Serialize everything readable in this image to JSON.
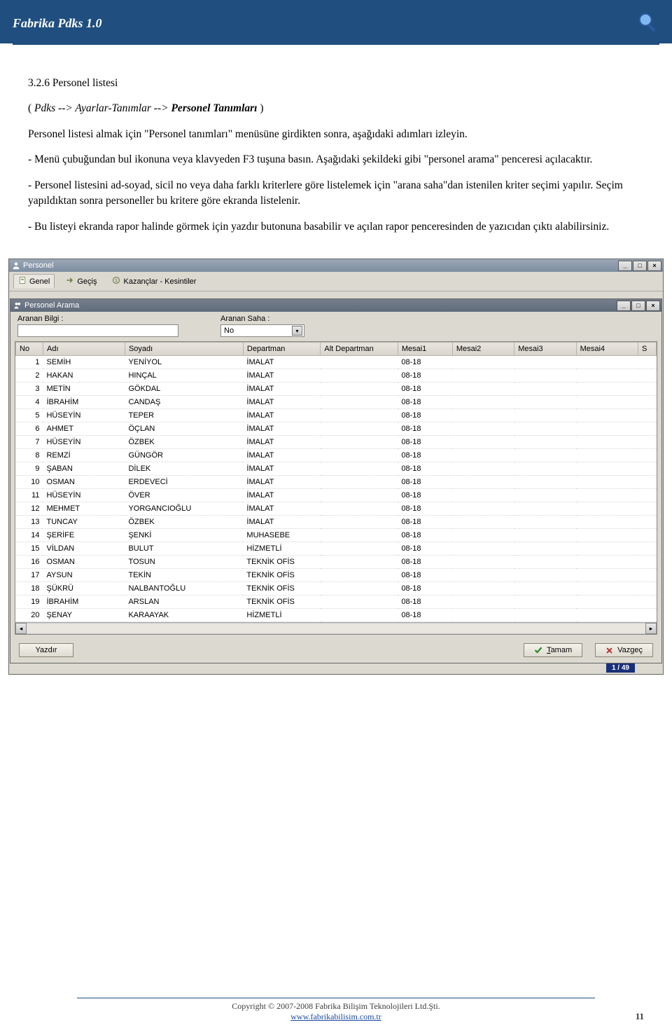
{
  "header": {
    "title": "Fabrika Pdks 1.0"
  },
  "section": {
    "title": "3.2.6 Personel listesi",
    "breadcrumb_open": "( ",
    "breadcrumb_italic": "Pdks --> Ayarlar-Tanımlar --> ",
    "breadcrumb_bold": "Personel Tanımları",
    "breadcrumb_close": " )",
    "p1": "Personel listesi almak için \"Personel tanımları\" menüsüne girdikten sonra, aşağıdaki adımları izleyin.",
    "p2": "- Menü çubuğundan bul ikonuna veya klavyeden F3 tuşuna basın. Aşağıdaki şekildeki gibi \"personel arama\" penceresi açılacaktır.",
    "p3": "- Personel listesini ad-soyad, sicil no veya daha farklı kriterlere göre listelemek için \"arana saha\"dan istenilen kriter seçimi yapılır. Seçim yapıldıktan sonra personeller bu kritere göre ekranda listelenir.",
    "p4": "- Bu listeyi ekranda rapor halinde görmek için yazdır butonuna basabilir ve açılan rapor penceresinden de yazıcıdan çıktı alabilirsiniz."
  },
  "outer_window": {
    "title": "Personel",
    "tabs": [
      "Genel",
      "Geçiş",
      "Kazançlar - Kesintiler"
    ]
  },
  "inner_window": {
    "title": "Personel Arama",
    "search_label_left": "Aranan Bilgi  :",
    "search_label_right": "Aranan Saha  :",
    "search_value": "",
    "select_value": "No"
  },
  "table": {
    "columns": [
      "No",
      "Adı",
      "Soyadı",
      "Departman",
      "Alt Departman",
      "Mesai1",
      "Mesai2",
      "Mesai3",
      "Mesai4",
      "S"
    ],
    "rows": [
      {
        "no": "1",
        "ad": "SEMİH",
        "soyad": "YENİYOL",
        "dep": "İMALAT",
        "altdep": "",
        "m1": "08-18",
        "m2": "",
        "m3": "",
        "m4": ""
      },
      {
        "no": "2",
        "ad": "HAKAN",
        "soyad": "HINÇAL",
        "dep": "İMALAT",
        "altdep": "",
        "m1": "08-18",
        "m2": "",
        "m3": "",
        "m4": ""
      },
      {
        "no": "3",
        "ad": "METİN",
        "soyad": "GÖKDAL",
        "dep": "İMALAT",
        "altdep": "",
        "m1": "08-18",
        "m2": "",
        "m3": "",
        "m4": ""
      },
      {
        "no": "4",
        "ad": "İBRAHİM",
        "soyad": "CANDAŞ",
        "dep": "İMALAT",
        "altdep": "",
        "m1": "08-18",
        "m2": "",
        "m3": "",
        "m4": ""
      },
      {
        "no": "5",
        "ad": "HÜSEYİN",
        "soyad": "TEPER",
        "dep": "İMALAT",
        "altdep": "",
        "m1": "08-18",
        "m2": "",
        "m3": "",
        "m4": ""
      },
      {
        "no": "6",
        "ad": "AHMET",
        "soyad": "ÖÇLAN",
        "dep": "İMALAT",
        "altdep": "",
        "m1": "08-18",
        "m2": "",
        "m3": "",
        "m4": ""
      },
      {
        "no": "7",
        "ad": "HÜSEYİN",
        "soyad": "ÖZBEK",
        "dep": "İMALAT",
        "altdep": "",
        "m1": "08-18",
        "m2": "",
        "m3": "",
        "m4": ""
      },
      {
        "no": "8",
        "ad": "REMZİ",
        "soyad": "GÜNGÖR",
        "dep": "İMALAT",
        "altdep": "",
        "m1": "08-18",
        "m2": "",
        "m3": "",
        "m4": ""
      },
      {
        "no": "9",
        "ad": "ŞABAN",
        "soyad": "DİLEK",
        "dep": "İMALAT",
        "altdep": "",
        "m1": "08-18",
        "m2": "",
        "m3": "",
        "m4": ""
      },
      {
        "no": "10",
        "ad": "OSMAN",
        "soyad": "ERDEVECİ",
        "dep": "İMALAT",
        "altdep": "",
        "m1": "08-18",
        "m2": "",
        "m3": "",
        "m4": ""
      },
      {
        "no": "11",
        "ad": "HÜSEYİN",
        "soyad": "ÖVER",
        "dep": "İMALAT",
        "altdep": "",
        "m1": "08-18",
        "m2": "",
        "m3": "",
        "m4": ""
      },
      {
        "no": "12",
        "ad": "MEHMET",
        "soyad": "YORGANCIOĞLU",
        "dep": "İMALAT",
        "altdep": "",
        "m1": "08-18",
        "m2": "",
        "m3": "",
        "m4": ""
      },
      {
        "no": "13",
        "ad": "TUNCAY",
        "soyad": "ÖZBEK",
        "dep": "İMALAT",
        "altdep": "",
        "m1": "08-18",
        "m2": "",
        "m3": "",
        "m4": ""
      },
      {
        "no": "14",
        "ad": "ŞERİFE",
        "soyad": "ŞENKİ",
        "dep": "MUHASEBE",
        "altdep": "",
        "m1": "08-18",
        "m2": "",
        "m3": "",
        "m4": ""
      },
      {
        "no": "15",
        "ad": "VİLDAN",
        "soyad": "BULUT",
        "dep": "HİZMETLİ",
        "altdep": "",
        "m1": "08-18",
        "m2": "",
        "m3": "",
        "m4": ""
      },
      {
        "no": "16",
        "ad": "OSMAN",
        "soyad": "TOSUN",
        "dep": "TEKNİK OFİS",
        "altdep": "",
        "m1": "08-18",
        "m2": "",
        "m3": "",
        "m4": ""
      },
      {
        "no": "17",
        "ad": "AYSUN",
        "soyad": "TEKİN",
        "dep": "TEKNİK OFİS",
        "altdep": "",
        "m1": "08-18",
        "m2": "",
        "m3": "",
        "m4": ""
      },
      {
        "no": "18",
        "ad": "ŞÜKRÜ",
        "soyad": "NALBANTOĞLU",
        "dep": "TEKNİK OFİS",
        "altdep": "",
        "m1": "08-18",
        "m2": "",
        "m3": "",
        "m4": ""
      },
      {
        "no": "19",
        "ad": "İBRAHİM",
        "soyad": "ARSLAN",
        "dep": "TEKNİK OFİS",
        "altdep": "",
        "m1": "08-18",
        "m2": "",
        "m3": "",
        "m4": ""
      },
      {
        "no": "20",
        "ad": "ŞENAY",
        "soyad": "KARAAYAK",
        "dep": "HİZMETLİ",
        "altdep": "",
        "m1": "08-18",
        "m2": "",
        "m3": "",
        "m4": ""
      }
    ]
  },
  "footer_buttons": {
    "print": "Yazdır",
    "ok_u": "T",
    "ok_rest": "amam",
    "cancel": "Vazgeç"
  },
  "status_counter": "1 / 49",
  "page_footer": {
    "copyright": "Copyright © 2007-2008 Fabrika Bilişim Teknolojileri Ltd.Şti.",
    "link": "www.fabrikabilisim.com.tr",
    "page_no": "11"
  }
}
